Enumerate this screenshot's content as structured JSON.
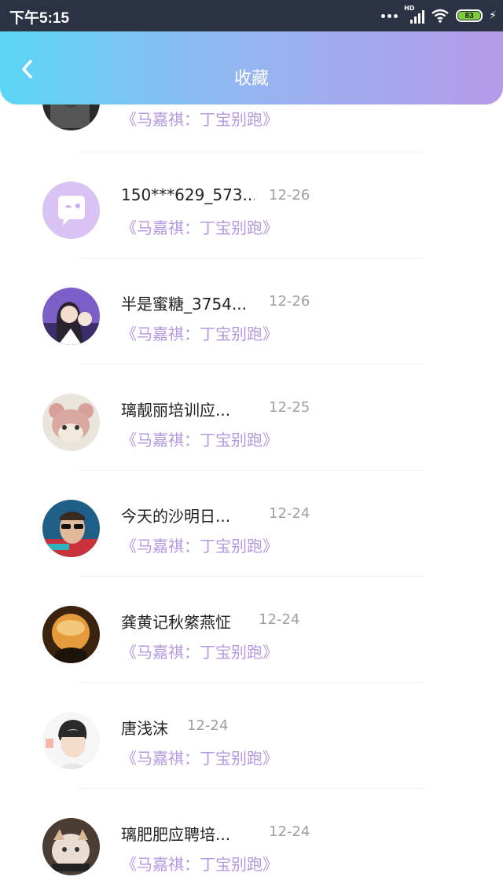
{
  "status_bar": {
    "time": "下午5:15",
    "signal_label": "HD",
    "battery": "83"
  },
  "header": {
    "title": "收藏"
  },
  "list": [
    {
      "name": "",
      "date": "",
      "subtitle": "《马嘉祺：丁宝别跑》",
      "avatar": "dark-photo-avatar"
    },
    {
      "name": "150***629_573...",
      "date": "12-26",
      "subtitle": "《马嘉祺：丁宝别跑》",
      "avatar": "default-chat-avatar"
    },
    {
      "name": "半是蜜糖_3754...",
      "date": "12-26",
      "subtitle": "《马嘉祺：丁宝别跑》",
      "avatar": "girl-photo-avatar"
    },
    {
      "name": "璃靓丽培训应...",
      "date": "12-25",
      "subtitle": "《马嘉祺：丁宝别跑》",
      "avatar": "bear-cat-avatar"
    },
    {
      "name": "今天的沙明日...",
      "date": "12-24",
      "subtitle": "《马嘉祺：丁宝别跑》",
      "avatar": "sunglasses-man-avatar"
    },
    {
      "name": "龚黄记秋綮燕怔",
      "date": "12-24",
      "subtitle": "《马嘉祺：丁宝别跑》",
      "avatar": "glass-sphere-avatar"
    },
    {
      "name": "唐浅沫",
      "date": "12-24",
      "subtitle": "《马嘉祺：丁宝别跑》",
      "avatar": "boy-drawing-avatar"
    },
    {
      "name": "璃肥肥应聘培...",
      "date": "12-24",
      "subtitle": "《马嘉祺：丁宝别跑》",
      "avatar": "cat-meme-avatar"
    }
  ],
  "colors": {
    "header_start": "#5bd6f4",
    "header_end": "#b59ae8",
    "subtitle": "#b498e0",
    "date": "#9e9e9e"
  }
}
